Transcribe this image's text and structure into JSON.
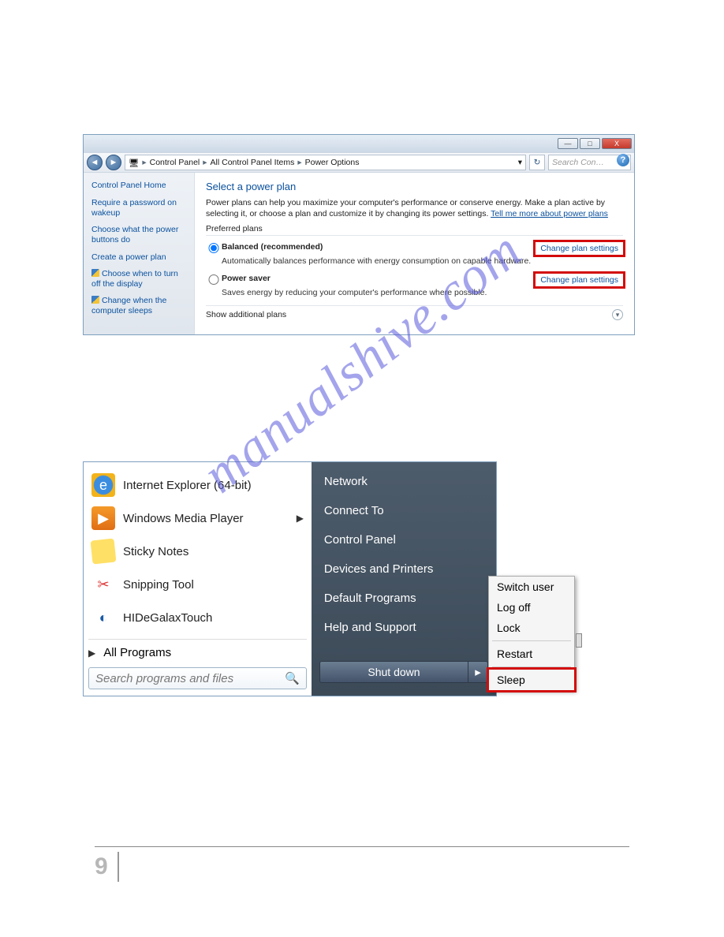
{
  "watermark": "manualshive.com",
  "page_number": "9",
  "power_options": {
    "win_buttons": {
      "min": "—",
      "max": "□",
      "close": "X"
    },
    "nav": {
      "back": "◄",
      "fwd": "►",
      "refresh": "↻",
      "dropdown": "▾"
    },
    "breadcrumb": [
      "Control Panel",
      "All Control Panel Items",
      "Power Options"
    ],
    "search_placeholder": "Search Con…",
    "help_icon": "?",
    "sidebar": {
      "home": "Control Panel Home",
      "links": [
        "Require a password on wakeup",
        "Choose what the power buttons do",
        "Create a power plan",
        "Choose when to turn off the display",
        "Change when the computer sleeps"
      ]
    },
    "heading": "Select a power plan",
    "description": "Power plans can help you maximize your computer's performance or conserve energy. Make a plan active by selecting it, or choose a plan and customize it by changing its power settings. ",
    "more_link": "Tell me more about power plans",
    "preferred_label": "Preferred plans",
    "plans": [
      {
        "name": "Balanced (recommended)",
        "sub": "Automatically balances performance with energy consumption on capable hardware.",
        "change": "Change plan settings",
        "checked": true
      },
      {
        "name": "Power saver",
        "sub": "Saves energy by reducing your computer's performance where possible.",
        "change": "Change plan settings",
        "checked": false
      }
    ],
    "show_more": "Show additional plans",
    "expand_glyph": "▾"
  },
  "start_menu": {
    "left": [
      {
        "icon": "ie-icon",
        "label": "Internet Explorer (64-bit)",
        "has_arrow": false
      },
      {
        "icon": "wmp-icon",
        "label": "Windows Media Player",
        "has_arrow": true
      },
      {
        "icon": "sticky-icon",
        "label": "Sticky Notes",
        "has_arrow": false
      },
      {
        "icon": "snip-icon",
        "label": "Snipping Tool",
        "has_arrow": false
      },
      {
        "icon": "hid-icon",
        "label": "HIDeGalaxTouch",
        "has_arrow": false
      }
    ],
    "all_programs": "All Programs",
    "search_placeholder": "Search programs and files",
    "search_icon": "🔍",
    "right": [
      "Network",
      "Connect To",
      "Control Panel",
      "Devices and Printers",
      "Default Programs",
      "Help and Support"
    ],
    "shutdown": "Shut down",
    "arrow": "▸",
    "power_menu": [
      "Switch user",
      "Log off",
      "Lock",
      "Restart",
      "Sleep"
    ]
  }
}
